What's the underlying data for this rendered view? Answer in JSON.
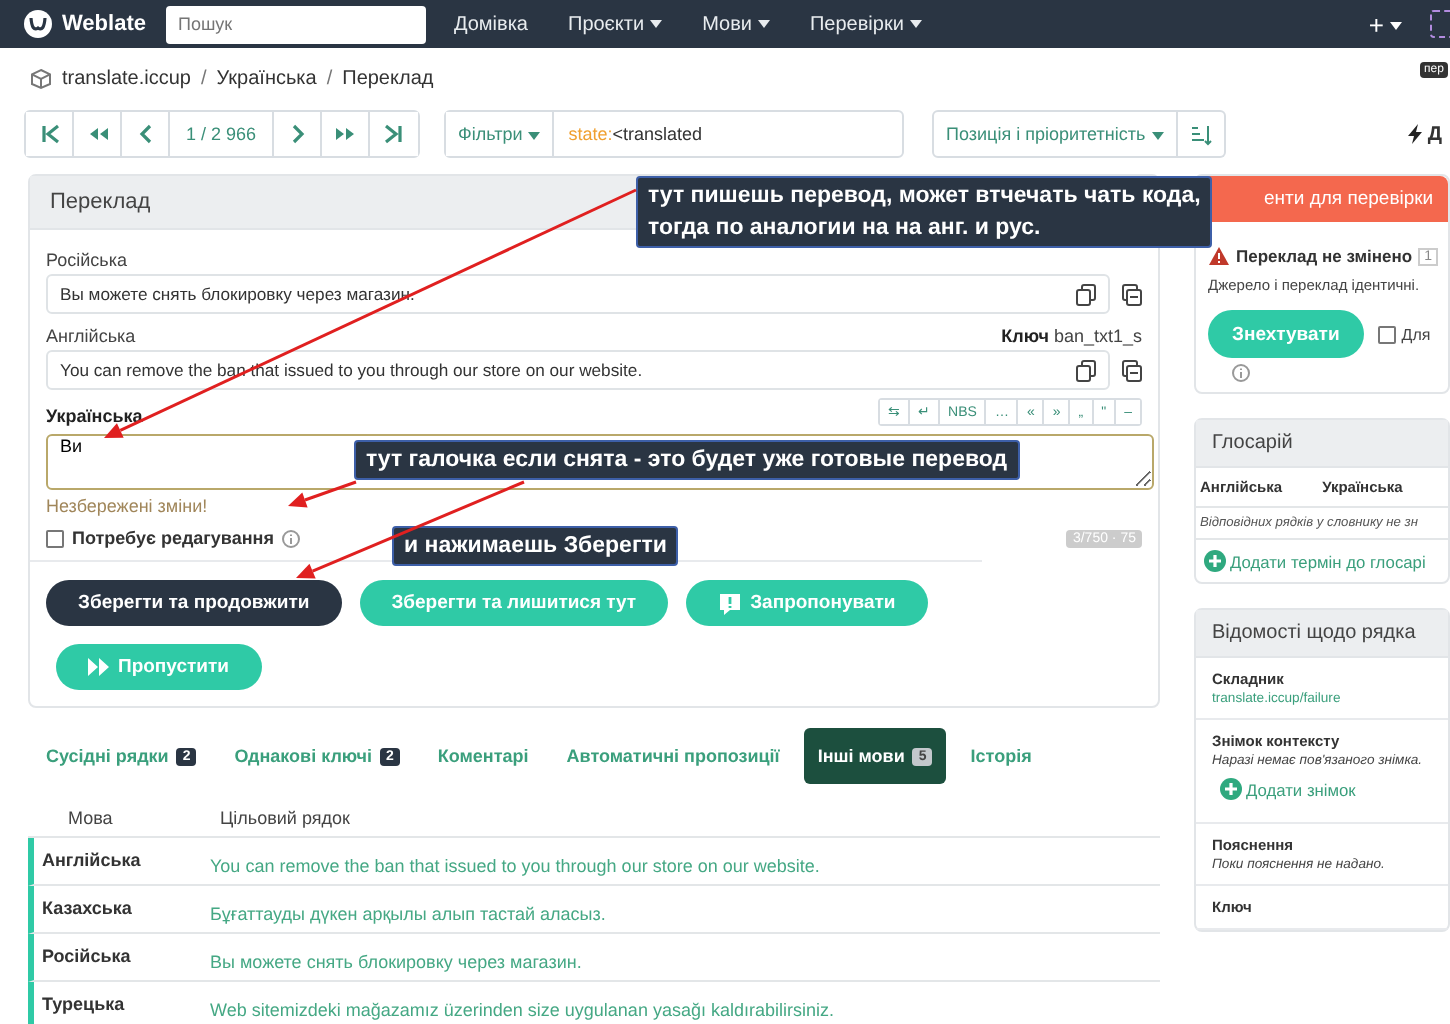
{
  "navbar": {
    "brand": "Weblate",
    "search": {
      "placeholder": "Пошук"
    },
    "menu": [
      {
        "label": "Домівка",
        "dropdown": false
      },
      {
        "label": "Проєкти",
        "dropdown": true
      },
      {
        "label": "Мови",
        "dropdown": true
      },
      {
        "label": "Перевірки",
        "dropdown": true
      }
    ],
    "add": "+"
  },
  "tooltip": "пер",
  "breadcrumb": {
    "items": [
      "translate.iccup",
      "Українська",
      "Переклад"
    ],
    "separator": "/"
  },
  "toolbar": {
    "position": "1 / 2 966",
    "filter_label": "Фільтри",
    "query_key": "state:",
    "query_value": "<translated",
    "sort_label": "Позиція і пріоритетність",
    "right_label": "Д"
  },
  "translation": {
    "title": "Переклад",
    "sources": [
      {
        "language": "Російська",
        "text": "Вы можете снять блокировку через магазин."
      },
      {
        "language": "Англійська",
        "text": "You can remove the ban that issued to you through our store on our website.",
        "key_label": "Ключ",
        "key_value": "ban_txt1_s"
      }
    ],
    "target": {
      "language": "Українська",
      "value": "Ви",
      "specials": [
        "⇆",
        "↵",
        "NBS",
        "…",
        "«",
        "»",
        "„",
        "\"",
        "–"
      ]
    },
    "unsaved": "Незбережені зміни!",
    "needs_editing": {
      "label": "Потребує редагування",
      "checked": false
    },
    "counter": "3/750 · 75",
    "buttons": [
      {
        "label": "Зберегти та продовжити",
        "kind": "dark"
      },
      {
        "label": "Зберегти та лишитися тут",
        "kind": "teal"
      },
      {
        "label": "Запропонувати",
        "kind": "suggest"
      },
      {
        "label": "Пропустити",
        "kind": "skip"
      }
    ]
  },
  "tabs": [
    {
      "label": "Сусідні рядки",
      "count": "2",
      "selected": false
    },
    {
      "label": "Однакові ключі",
      "count": "2",
      "selected": false
    },
    {
      "label": "Коментарі",
      "selected": false
    },
    {
      "label": "Автоматичні пропозиції",
      "selected": false
    },
    {
      "label": "Інші мови",
      "count": "5",
      "selected": true
    },
    {
      "label": "Історія",
      "selected": false
    }
  ],
  "other_languages": {
    "columns": [
      "Мова",
      "Цільовий рядок"
    ],
    "rows": [
      {
        "language": "Англійська",
        "text": "You can remove the ban that issued to you through our store on our website."
      },
      {
        "language": "Казахська",
        "text": "Бұғаттауды дүкен арқылы алып тастай аласыз."
      },
      {
        "language": "Російська",
        "text": "Вы можете снять блокировку через магазин."
      },
      {
        "language": "Турецька",
        "text": "Web sitemizdeki mağazamız üzerinden size uygulanan yasağı kaldırabilirsiniz."
      }
    ]
  },
  "sidebar": {
    "checks": {
      "title": "енти для перевірки",
      "check_title": "Переклад не змінено",
      "count": "1",
      "description": "Джерело і переклад ідентичні.",
      "button": "Знехтувати",
      "checkbox": {
        "label": "Для",
        "checked": false
      }
    },
    "glossary": {
      "title": "Глосарій",
      "columns": [
        "Англійська",
        "Українська"
      ],
      "empty": "Відповідних рядків у словнику не зн",
      "add": "Додати термін до глосарі"
    },
    "info": {
      "title": "Відомості щодо рядка",
      "items": [
        {
          "label": "Складник",
          "value": "translate.iccup/failure",
          "kind": "link"
        },
        {
          "label": "Знімок контексту",
          "value": "Наразі немає пов'язаного знімка.",
          "kind": "note",
          "action": "Додати знімок"
        },
        {
          "label": "Пояснення",
          "value": "Поки пояснення не надано.",
          "kind": "note"
        },
        {
          "label": "Ключ",
          "kind": "label"
        }
      ]
    }
  },
  "annotations": [
    {
      "text": "тут пишешь перевод, может втчечать чать кода,\nтогда по аналогии на на анг. и рус."
    },
    {
      "text": "тут галочка если снята - это будет уже готовые перевод"
    },
    {
      "text": "и нажимаешь Зберегти"
    }
  ]
}
